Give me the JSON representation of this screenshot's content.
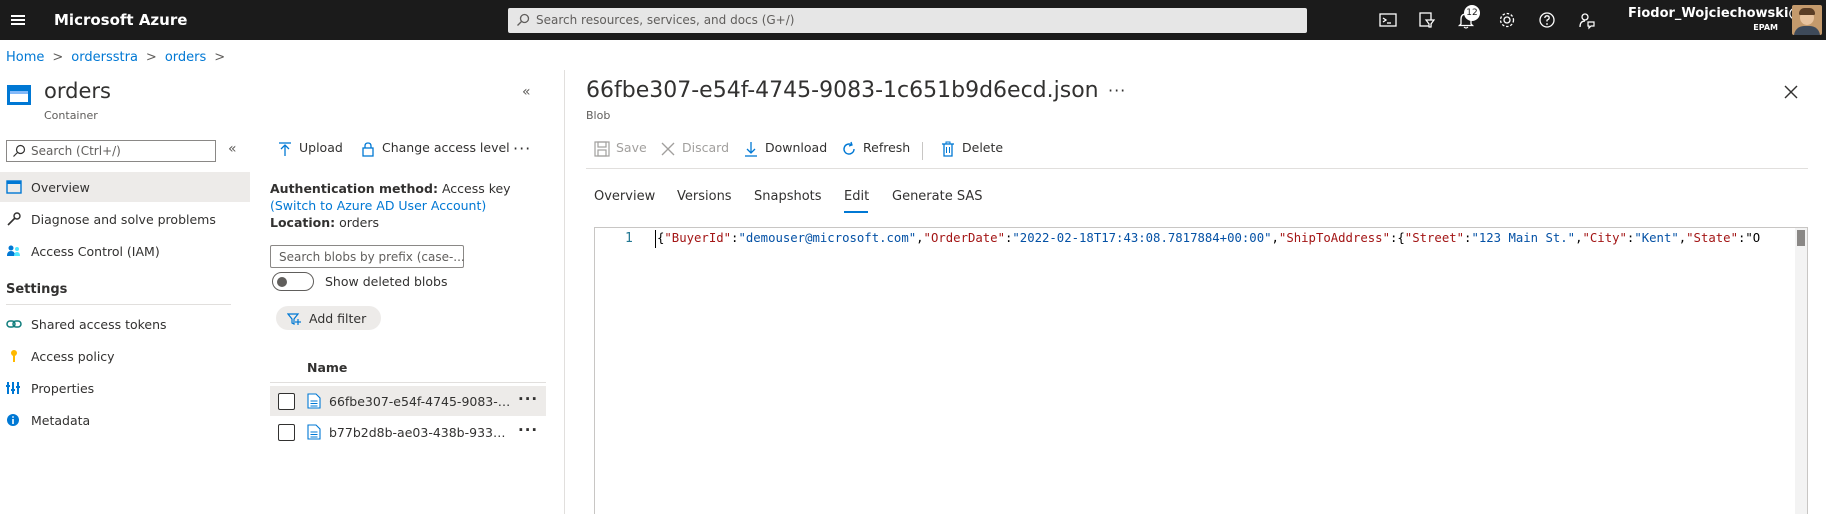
{
  "topbar": {
    "brand": "Microsoft Azure",
    "search_placeholder": "Search resources, services, and docs (G+/)",
    "notifications_count": "12",
    "user_name": "Fiodor_Wojciechowski@...",
    "user_org": "EPAM",
    "colors": {
      "background": "#1b1b1b",
      "accent": "#0078d4"
    }
  },
  "breadcrumb": [
    "Home",
    "ordersstra",
    "orders"
  ],
  "container": {
    "title": "orders",
    "subtitle": "Container"
  },
  "nav": {
    "search_placeholder": "Search (Ctrl+/)",
    "items": [
      {
        "label": "Overview",
        "icon": "overview-icon"
      },
      {
        "label": "Diagnose and solve problems",
        "icon": "wrench-icon"
      },
      {
        "label": "Access Control (IAM)",
        "icon": "people-icon"
      }
    ],
    "settings_header": "Settings",
    "settings_items": [
      {
        "label": "Shared access tokens",
        "icon": "link-icon"
      },
      {
        "label": "Access policy",
        "icon": "key-icon"
      },
      {
        "label": "Properties",
        "icon": "properties-icon"
      },
      {
        "label": "Metadata",
        "icon": "info-icon"
      }
    ]
  },
  "container_toolbar": {
    "upload": "Upload",
    "change_access": "Change access level"
  },
  "auth": {
    "method_label": "Authentication method:",
    "method_value": "Access key",
    "switch_link": "(Switch to Azure AD User Account)",
    "location_label": "Location:",
    "location_value": "orders"
  },
  "blob_filter": {
    "prefix_placeholder": "Search blobs by prefix (case-...",
    "show_deleted": "Show deleted blobs",
    "add_filter": "Add filter"
  },
  "blob_list": {
    "column_name": "Name",
    "rows": [
      {
        "name": "66fbe307-e54f-4745-9083-1c6...",
        "selected": true
      },
      {
        "name": "b77b2d8b-ae03-438b-9338-1...",
        "selected": false
      }
    ]
  },
  "blob": {
    "title": "66fbe307-e54f-4745-9083-1c651b9d6ecd.json",
    "subtitle": "Blob",
    "toolbar": {
      "save": "Save",
      "discard": "Discard",
      "download": "Download",
      "refresh": "Refresh",
      "delete": "Delete"
    },
    "tabs": [
      "Overview",
      "Versions",
      "Snapshots",
      "Edit",
      "Generate SAS"
    ],
    "active_tab": "Edit",
    "editor": {
      "line_number": "1",
      "tokens": [
        {
          "t": "p",
          "s": "{"
        },
        {
          "t": "k",
          "s": "\"BuyerId\""
        },
        {
          "t": "p",
          "s": ":"
        },
        {
          "t": "v",
          "s": "\"demouser@microsoft.com\""
        },
        {
          "t": "p",
          "s": ","
        },
        {
          "t": "k",
          "s": "\"OrderDate\""
        },
        {
          "t": "p",
          "s": ":"
        },
        {
          "t": "v",
          "s": "\"2022-02-18T17:43:08.7817884+00:00\""
        },
        {
          "t": "p",
          "s": ","
        },
        {
          "t": "k",
          "s": "\"ShipToAddress\""
        },
        {
          "t": "p",
          "s": ":{"
        },
        {
          "t": "k",
          "s": "\"Street\""
        },
        {
          "t": "p",
          "s": ":"
        },
        {
          "t": "v",
          "s": "\"123 Main St.\""
        },
        {
          "t": "p",
          "s": ","
        },
        {
          "t": "k",
          "s": "\"City\""
        },
        {
          "t": "p",
          "s": ":"
        },
        {
          "t": "v",
          "s": "\"Kent\""
        },
        {
          "t": "p",
          "s": ","
        },
        {
          "t": "k",
          "s": "\"State\""
        },
        {
          "t": "p",
          "s": ":\"O"
        }
      ]
    }
  }
}
